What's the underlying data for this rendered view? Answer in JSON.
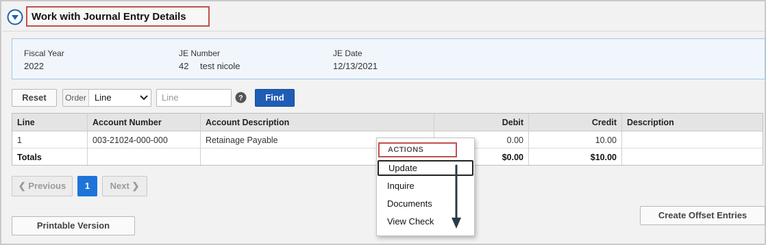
{
  "page": {
    "title": "Work with Journal Entry Details"
  },
  "info": {
    "fiscal_year_label": "Fiscal Year",
    "fiscal_year": "2022",
    "je_number_label": "JE Number",
    "je_number": "42",
    "je_description": "test nicole",
    "je_date_label": "JE Date",
    "je_date": "12/13/2021"
  },
  "toolbar": {
    "reset_label": "Reset",
    "order_label": "Order",
    "order_selected": "Line",
    "line_placeholder": "Line",
    "find_label": "Find"
  },
  "grid": {
    "columns": [
      "Line",
      "Account Number",
      "Account Description",
      "Debit",
      "Credit",
      "Description"
    ],
    "rows": [
      [
        "1",
        "003-21024-000-000",
        "Retainage Payable",
        "0.00",
        "10.00",
        ""
      ]
    ],
    "totals": [
      "Totals",
      "",
      "",
      "$0.00",
      "$10.00",
      ""
    ]
  },
  "pager": {
    "previous_label": "Previous",
    "current_page": "1",
    "next_label": "Next"
  },
  "footer": {
    "printable_label": "Printable Version",
    "offset_label": "Create Offset Entries"
  },
  "actions_menu": {
    "header": "ACTIONS",
    "items": [
      "Update",
      "Inquire",
      "Documents",
      "View Check"
    ]
  },
  "colors": {
    "accent_blue": "#1f5db5",
    "highlight_red": "#c0504d",
    "page_active": "#1f74d9"
  }
}
